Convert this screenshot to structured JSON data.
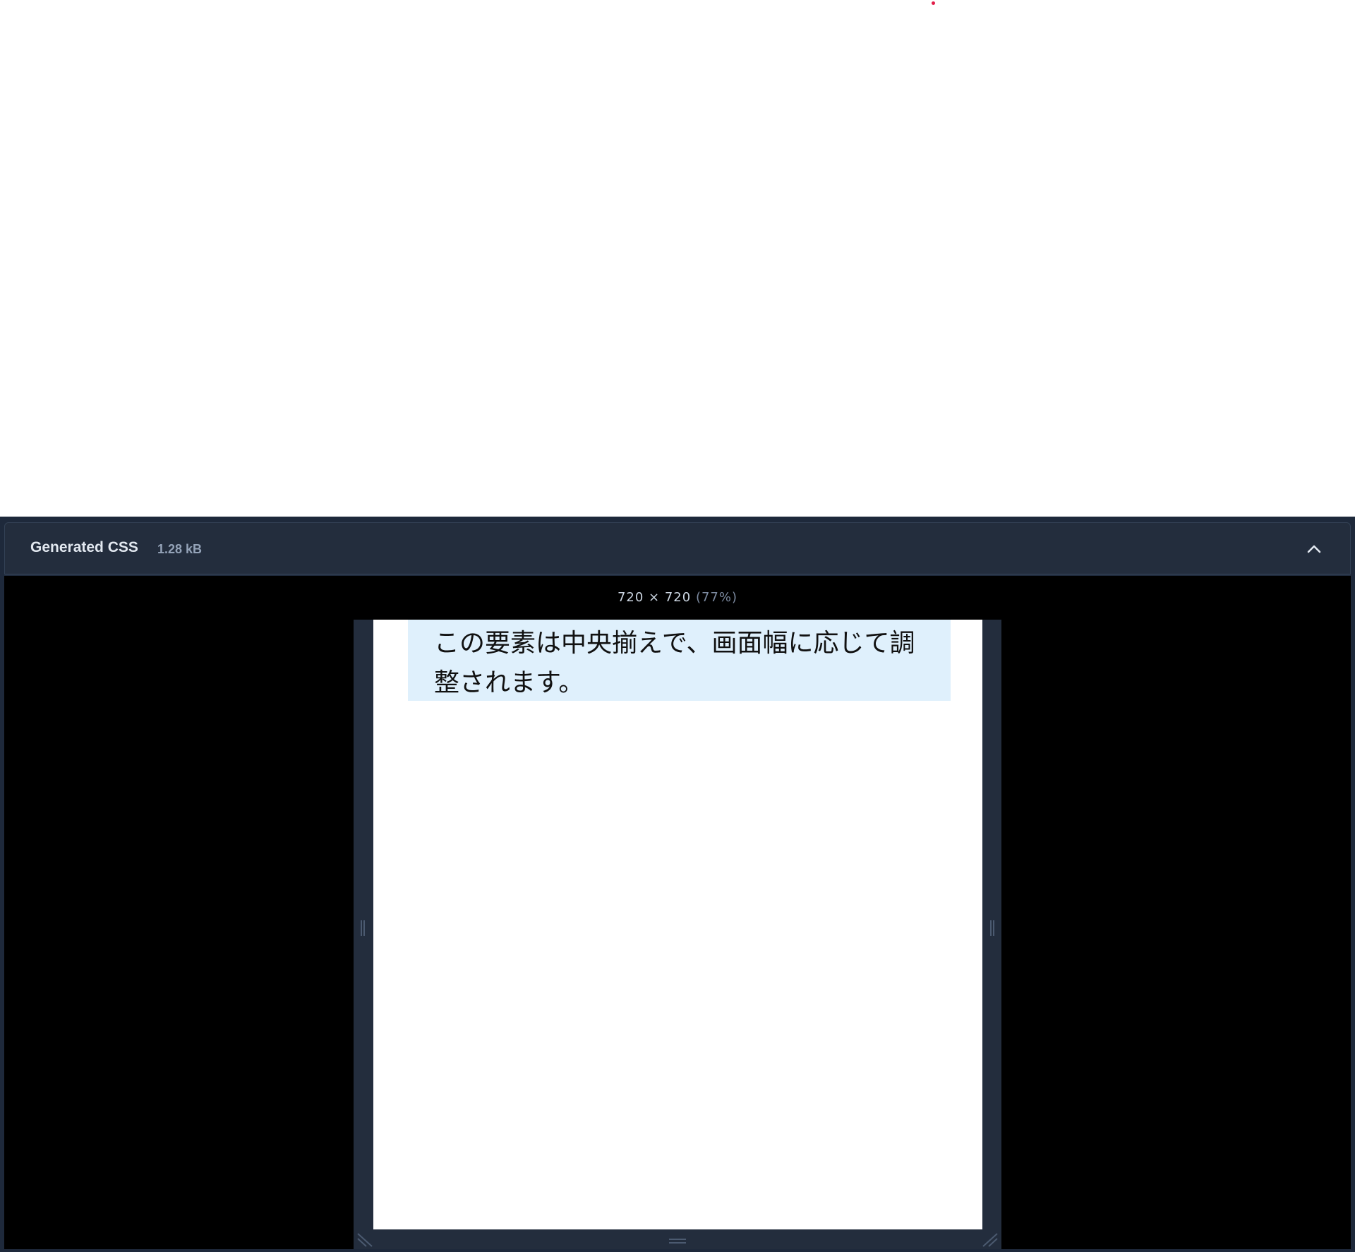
{
  "panel": {
    "title": "Generated CSS",
    "size": "1.28 kB",
    "collapse_icon": "chevron-up-icon"
  },
  "preview": {
    "dimensions": "720 × 720",
    "zoom": "(77%)",
    "content_text": "この要素は中央揃えで、画面幅に応じて調整されます。"
  },
  "colors": {
    "panel_bg": "#1e293b",
    "header_bg": "#232d3d",
    "preview_bg": "#000000",
    "box_bg": "#dff0fc",
    "accent_dot": "#e11d48"
  }
}
